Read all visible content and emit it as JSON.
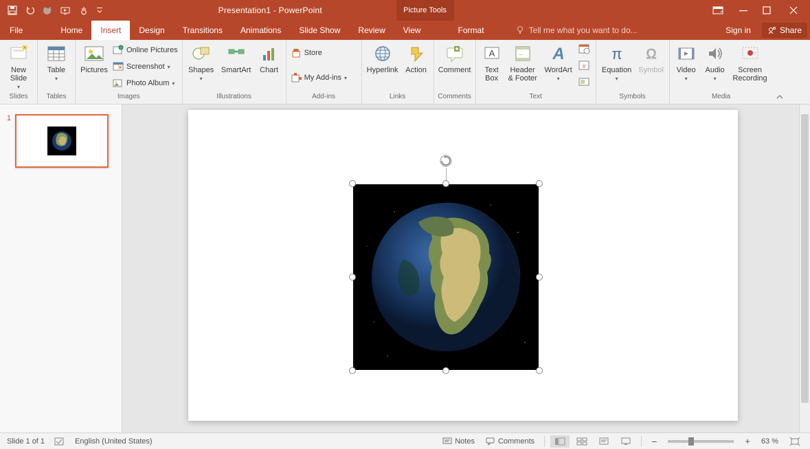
{
  "title": "Presentation1 - PowerPoint",
  "context_tab_header": "Picture Tools",
  "tabs": {
    "file": "File",
    "home": "Home",
    "insert": "Insert",
    "design": "Design",
    "transitions": "Transitions",
    "animations": "Animations",
    "slideshow": "Slide Show",
    "review": "Review",
    "view": "View",
    "format": "Format"
  },
  "tellme": "Tell me what you want to do...",
  "signin": "Sign in",
  "share": "Share",
  "ribbon": {
    "slides": {
      "label": "Slides",
      "new_slide": "New\nSlide"
    },
    "tables": {
      "label": "Tables",
      "table": "Table"
    },
    "images": {
      "label": "Images",
      "pictures": "Pictures",
      "online_pictures": "Online Pictures",
      "screenshot": "Screenshot",
      "photo_album": "Photo Album"
    },
    "illustrations": {
      "label": "Illustrations",
      "shapes": "Shapes",
      "smartart": "SmartArt",
      "chart": "Chart"
    },
    "addins": {
      "label": "Add-ins",
      "store": "Store",
      "my_addins": "My Add-ins"
    },
    "links": {
      "label": "Links",
      "hyperlink": "Hyperlink",
      "action": "Action"
    },
    "comments": {
      "label": "Comments",
      "comment": "Comment"
    },
    "text": {
      "label": "Text",
      "text_box": "Text\nBox",
      "header_footer": "Header\n& Footer",
      "wordart": "WordArt"
    },
    "symbols": {
      "label": "Symbols",
      "equation": "Equation",
      "symbol": "Symbol"
    },
    "media": {
      "label": "Media",
      "video": "Video",
      "audio": "Audio",
      "screen_recording": "Screen\nRecording"
    }
  },
  "thumb_number": "1",
  "status": {
    "slide_of": "Slide 1 of 1",
    "language": "English (United States)",
    "notes": "Notes",
    "comments": "Comments",
    "zoom": "63 %"
  }
}
